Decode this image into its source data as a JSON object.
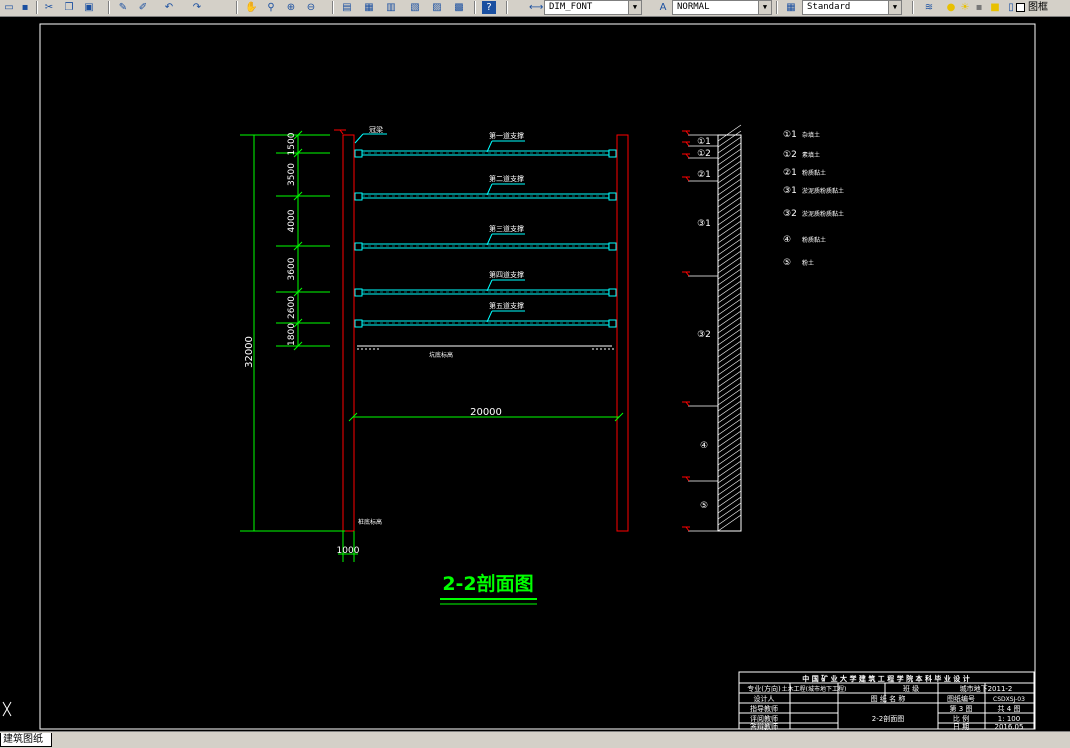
{
  "toolbar": {
    "dimstyle": "DIM_FONT",
    "textstyle": "NORMAL",
    "tablestyle": "Standard",
    "frame_label": "图框"
  },
  "status": {
    "tab": "建筑图纸"
  },
  "icons": [
    "open-icon",
    "save-icon",
    "cut-icon",
    "copy-icon",
    "paste-icon",
    "match-properties-icon",
    "brush-icon",
    "undo-icon",
    "redo-icon",
    "pan-icon",
    "zoom-realtime-icon",
    "zoom-window-icon",
    "zoom-previous-icon",
    "properties-icon",
    "design-center-icon",
    "tool-palette-icon",
    "sheet-set-icon",
    "markup-icon",
    "calculator-icon",
    "help-icon"
  ],
  "colors": {
    "background": "#000000",
    "frame": "#ffffff",
    "wall": "#ff0000",
    "dim": "#00ff00",
    "strut": "#00ffff",
    "title": "#00ff00"
  },
  "drawing": {
    "title": "2-2剖面图",
    "dims_left": [
      "1500",
      "3500",
      "4000",
      "3600",
      "2600",
      "1800"
    ],
    "total_height": "32000",
    "width": "20000",
    "wall_thickness": "1000",
    "crown_label": "冠梁",
    "struts": [
      "第一道支撑",
      "第二道支撑",
      "第三道支撑",
      "第四道支撑",
      "第五道支撑"
    ],
    "pit_bottom": "坑底标高",
    "pile_bottom": "桩底标高",
    "soil_layers": [
      "①1",
      "①2",
      "②1",
      "③1",
      "③2",
      "④",
      "⑤"
    ],
    "legend": [
      {
        "symbol": "①1",
        "name": "杂填土"
      },
      {
        "symbol": "①2",
        "name": "素填土"
      },
      {
        "symbol": "②1",
        "name": "粉质黏土"
      },
      {
        "symbol": "③1",
        "name": "淤泥质粉质黏土"
      },
      {
        "symbol": "③2",
        "name": "淤泥质粉质黏土"
      },
      {
        "symbol": "④",
        "name": "粉质黏土"
      },
      {
        "symbol": "⑤",
        "name": "粉土"
      }
    ]
  },
  "titleblock": {
    "header": "中 国 矿 业 大 学 建 筑 工 程 学 院 本 科 毕 业 设 计",
    "r1": [
      "专业(方向)",
      "土木工程(城市地下工程)",
      "班 级",
      "城市地下2011-2"
    ],
    "r2": [
      "设计人",
      "图 纸 名 称",
      "图纸编号",
      "CSDXSJ-03"
    ],
    "r3": [
      "指导教师",
      "第 3 图",
      "共 4 图"
    ],
    "r4": [
      "评阅教师",
      "2-2剖面图",
      "比 例",
      "1: 100"
    ],
    "r5": [
      "答辩教师",
      "日 期",
      "2016.05"
    ]
  }
}
